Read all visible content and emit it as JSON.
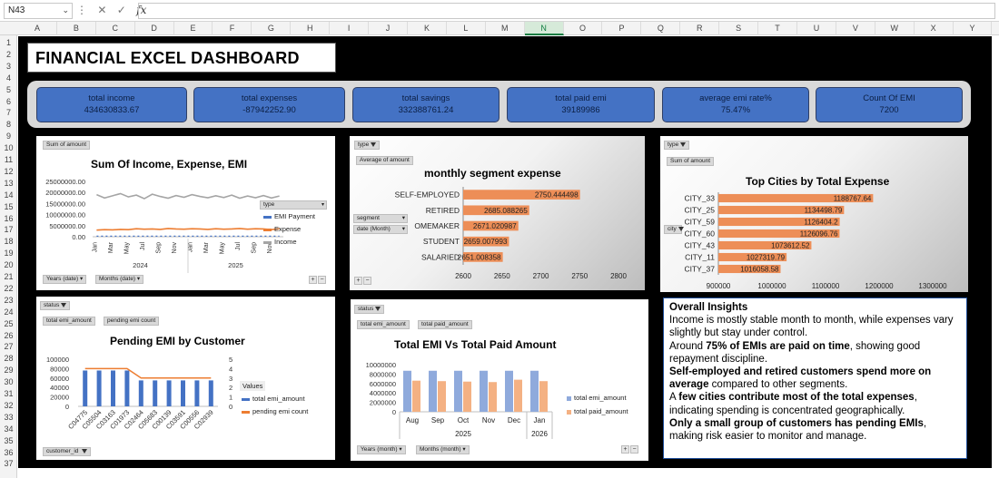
{
  "formula_bar": {
    "cell_ref": "N43",
    "formula": ""
  },
  "columns": [
    "A",
    "B",
    "C",
    "D",
    "E",
    "F",
    "G",
    "H",
    "I",
    "J",
    "K",
    "L",
    "M",
    "N",
    "O",
    "P",
    "Q",
    "R",
    "S",
    "T",
    "U",
    "V",
    "W",
    "X",
    "Y"
  ],
  "rows": [
    "1",
    "2",
    "3",
    "4",
    "5",
    "6",
    "7",
    "8",
    "9",
    "10",
    "11",
    "12",
    "13",
    "14",
    "15",
    "16",
    "17",
    "18",
    "19",
    "20",
    "21",
    "22",
    "23",
    "24",
    "25",
    "26",
    "27",
    "28",
    "29",
    "30",
    "31",
    "32",
    "33",
    "34",
    "35",
    "36",
    "37"
  ],
  "dashboard_title": "FINANCIAL EXCEL DASHBOARD",
  "kpis": [
    {
      "label": "total income",
      "value": "434630833.67"
    },
    {
      "label": "total expenses",
      "value": "-87942252.90"
    },
    {
      "label": "total savings",
      "value": "332388761.24"
    },
    {
      "label": "total paid emi",
      "value": "39189986"
    },
    {
      "label": "average emi rate%",
      "value": "75.47%"
    },
    {
      "label": "Count Of EMI",
      "value": "7200"
    }
  ],
  "panel1": {
    "field_button": "Sum of amount",
    "legend_field": "type",
    "bottom_buttons": [
      "Years (date)",
      "Months (date)"
    ],
    "chart_data": {
      "type": "line",
      "title": "Sum Of Income, Expense, EMI",
      "ylim": [
        0,
        25000000
      ],
      "y_ticks": [
        "25000000.00",
        "20000000.00",
        "15000000.00",
        "10000000.00",
        "5000000.00",
        "0.00"
      ],
      "x_month_labels": [
        "Jan",
        "Mar",
        "May",
        "Jul",
        "Sep",
        "Nov",
        "Jan",
        "Mar",
        "May",
        "Jul",
        "Sep",
        "Nov"
      ],
      "x_year_labels": [
        "2024",
        "2025"
      ],
      "series": [
        {
          "name": "EMI Payment",
          "color": "#4472c4",
          "values": [
            250000,
            250000,
            250000,
            250000,
            250000,
            250000,
            250000,
            250000,
            250000,
            250000,
            250000,
            250000,
            250000,
            250000,
            250000,
            250000,
            250000,
            250000,
            250000,
            250000,
            250000,
            250000,
            250000,
            250000
          ]
        },
        {
          "name": "Expense",
          "color": "#ed7d31",
          "values": [
            3000000,
            3200000,
            3100000,
            3300000,
            3200000,
            3600000,
            3400000,
            3500000,
            3300000,
            3700000,
            3500000,
            3400000,
            3600000,
            3500000,
            3300000,
            3600000,
            3400000,
            3500000,
            3700000,
            3400000,
            3600000,
            3500000,
            3200000,
            3600000
          ]
        },
        {
          "name": "Income",
          "color": "#a5a5a5",
          "values": [
            19000000,
            17500000,
            18500000,
            19500000,
            18000000,
            18800000,
            17200000,
            19200000,
            18200000,
            17400000,
            18600000,
            17800000,
            19000000,
            18200000,
            17600000,
            18500000,
            17700000,
            18800000,
            17400000,
            18400000,
            17600000,
            18600000,
            17500000,
            18400000
          ]
        }
      ]
    }
  },
  "panel2": {
    "filter_button": "type",
    "field_button": "Average of amount",
    "axis_buttons": [
      "segment",
      "date (Month)"
    ],
    "chart_data": {
      "type": "bar",
      "title": "monthly segment expense",
      "categories": [
        "SELF-EMPLOYED",
        "RETIRED",
        "HOMEMAKER",
        "STUDENT",
        "SALARIED"
      ],
      "category_display": [
        "SELF-EMPLOYED",
        "RETIRED",
        "OMEMAKER",
        "STUDENT",
        "SALARIED"
      ],
      "values": [
        2750.444498,
        2685.088265,
        2671.020987,
        2659.007993,
        2651.008358
      ],
      "value_labels": [
        "2750.444498",
        "2685.088265",
        "2671.020987",
        "2659.007993",
        "2651.008358"
      ],
      "xlim": [
        2600,
        2800
      ],
      "x_ticks": [
        "2600",
        "2650",
        "2700",
        "2750",
        "2800"
      ],
      "color": "#ed8e57"
    }
  },
  "panel3": {
    "filter_button": "type",
    "field_button": "Sum of amount",
    "axis_button": "city",
    "chart_data": {
      "type": "bar",
      "title": "Top Cities by Total Expense",
      "categories": [
        "CITY_33",
        "CITY_25",
        "CITY_59",
        "CITY_60",
        "CITY_43",
        "CITY_11",
        "CITY_37"
      ],
      "values": [
        1188767.64,
        1134498.79,
        1126404.2,
        1126096.76,
        1073612.52,
        1027319.79,
        1016058.58
      ],
      "value_labels": [
        "1188767.64",
        "1134498.79",
        "1126404.2",
        "1126096.76",
        "1073612.52",
        "1027319.79",
        "1016058.58"
      ],
      "xlim": [
        900000,
        1300000
      ],
      "x_ticks": [
        "900000",
        "1000000",
        "1100000",
        "1200000",
        "1300000"
      ],
      "color": "#ed8e57"
    }
  },
  "panel4": {
    "filter_button": "status",
    "value_buttons": [
      "total emi_amount",
      "pending emi count"
    ],
    "axis_button": "customer_id",
    "legend_title": "Values",
    "chart_data": {
      "type": "bar",
      "title": "Pending EMI by Customer",
      "categories": [
        "C04775",
        "C05504",
        "C03163",
        "C01973",
        "C02464",
        "C05683",
        "C00139",
        "C03591",
        "C00556",
        "C02939"
      ],
      "series": [
        {
          "name": "total emi_amount",
          "color": "#4472c4",
          "values": [
            76000,
            76000,
            76000,
            76000,
            55000,
            55000,
            55000,
            55000,
            55000,
            55000
          ]
        },
        {
          "name": "pending emi count",
          "color": "#ed7d31",
          "values": [
            4,
            4,
            4,
            4,
            3,
            3,
            3,
            3,
            3,
            3
          ]
        }
      ],
      "ylim": [
        0,
        100000
      ],
      "y_ticks": [
        "100000",
        "80000",
        "60000",
        "40000",
        "20000",
        "0"
      ],
      "y2lim": [
        0,
        5
      ],
      "y2_ticks": [
        "5",
        "4",
        "3",
        "2",
        "1",
        "0"
      ]
    }
  },
  "panel5": {
    "filter_button": "status",
    "value_buttons": [
      "total emi_amount",
      "total paid_amount"
    ],
    "bottom_buttons": [
      "Years (month)",
      "Months (month)"
    ],
    "chart_data": {
      "type": "bar",
      "title": "Total EMI Vs Total Paid Amount",
      "categories": [
        "Aug",
        "Sep",
        "Oct",
        "Nov",
        "Dec",
        "Jan"
      ],
      "year_labels": [
        "2025",
        "2026"
      ],
      "series": [
        {
          "name": "total emi_amount",
          "color": "#8faadc",
          "values": [
            8700000,
            8700000,
            8700000,
            8700000,
            8700000,
            8700000
          ]
        },
        {
          "name": "total paid_amount",
          "color": "#f4b183",
          "values": [
            6600000,
            6500000,
            6400000,
            6300000,
            6800000,
            6500000
          ]
        }
      ],
      "ylim": [
        0,
        10000000
      ],
      "y_ticks": [
        "10000000",
        "8000000",
        "6000000",
        "4000000",
        "2000000",
        "0"
      ]
    }
  },
  "insights": {
    "heading": "Overall Insights",
    "line1": "Income is mostly stable month to month, while expenses vary slightly but stay under control.",
    "line2_pre": "Around ",
    "line2_bold": "75% of EMIs are paid on time",
    "line2_post": ", showing good repayment discipline.",
    "line3_bold": "Self-employed and retired customers spend more on average",
    "line3_post": " compared to other segments.",
    "line4_pre": "A ",
    "line4_bold": "few cities contribute most of the total expenses",
    "line4_post": ", indicating spending is concentrated geographically.",
    "line5_bold": "Only a small group of customers has pending EMIs",
    "line5_post": ", making risk easier to monitor and manage."
  },
  "colors": {
    "kpi_fill": "#4472c4",
    "dashboard_bg": "#000000",
    "bar_orange": "#ed8e57",
    "selected_column": "#107c41"
  }
}
